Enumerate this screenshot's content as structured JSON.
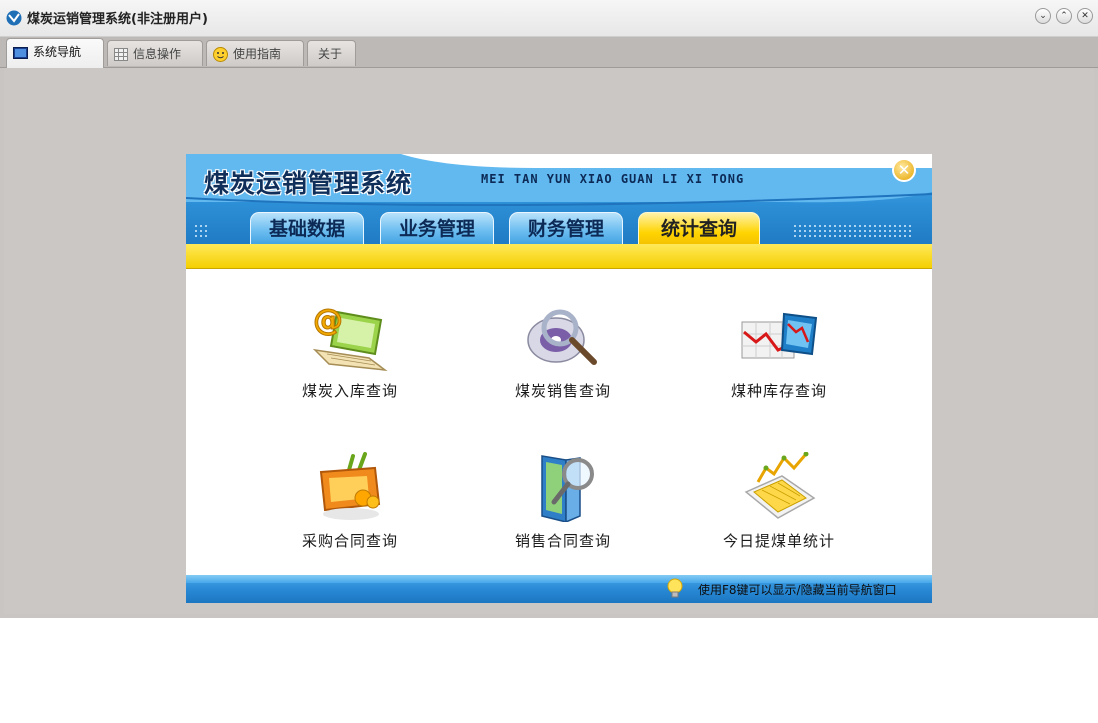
{
  "window": {
    "title": "煤炭运销管理系统(非注册用户)"
  },
  "window_controls": [
    {
      "symbol": "⌄",
      "name": "minimize-button"
    },
    {
      "symbol": "⌃",
      "name": "maximize-button"
    },
    {
      "symbol": "✕",
      "name": "close-button"
    }
  ],
  "tabs": [
    {
      "label": "系统导航",
      "icon": "monitor-icon",
      "active": true
    },
    {
      "label": "信息操作",
      "icon": "grid-icon",
      "active": false
    },
    {
      "label": "使用指南",
      "icon": "help-face-icon",
      "active": false
    },
    {
      "label": "关于",
      "icon": "",
      "active": false
    }
  ],
  "nav": {
    "title": "煤炭运销管理系统",
    "pinyin": "MEI TAN YUN XIAO GUAN LI XI TONG",
    "close_symbol": "✕",
    "menu_tabs": [
      {
        "label": "基础数据",
        "active": false
      },
      {
        "label": "业务管理",
        "active": false
      },
      {
        "label": "财务管理",
        "active": false
      },
      {
        "label": "统计查询",
        "active": true
      }
    ],
    "functions": [
      {
        "label": "煤炭入库查询",
        "icon": "laptop-email-icon"
      },
      {
        "label": "煤炭销售查询",
        "icon": "magnifier-disc-icon"
      },
      {
        "label": "煤种库存查询",
        "icon": "chart-monitor-icon"
      },
      {
        "label": "采购合同查询",
        "icon": "tv-fruit-icon"
      },
      {
        "label": "销售合同查询",
        "icon": "binder-magnifier-icon"
      },
      {
        "label": "今日提煤单统计",
        "icon": "line-chart-device-icon"
      }
    ],
    "hint": "使用F8键可以显示/隐藏当前导航窗口",
    "colors": {
      "header_blue": "#2d8fd6",
      "active_tab_yellow": "#ffd400",
      "band_yellow": "#f4cf00"
    }
  }
}
